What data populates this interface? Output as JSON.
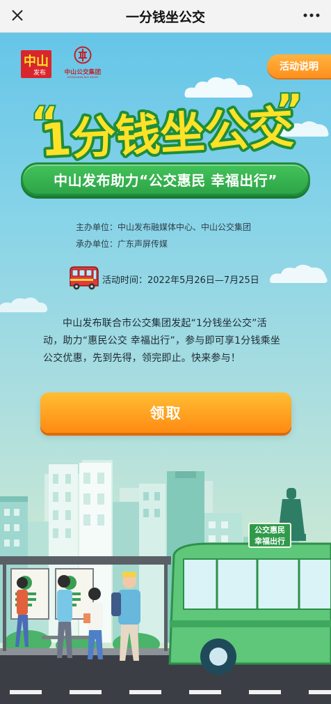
{
  "nav": {
    "title": "一分钱坐公交",
    "close_icon": "close-icon",
    "more_icon": "more-dots-icon"
  },
  "logos": {
    "zhongshan_fabu": "中山",
    "zhongshan_fabu_sub": "发布",
    "zhongshan_bus_name": "中山公交集团",
    "zhongshan_bus_en": "ZHONGSHAN BUS GROUP"
  },
  "rules_button": "活动说明",
  "title": {
    "open_quote": "“",
    "text": "1分钱坐公交",
    "close_quote": "”"
  },
  "subtitle": "中山发布助力“公交惠民 幸福出行”",
  "organizers": {
    "host": "主办单位：中山发布融媒体中心、中山公交集团",
    "organizer": "承办单位：广东声屏传媒"
  },
  "activity_time": "活动时间：2022年5月26日—7月25日",
  "description": "中山发布联合市公交集团发起“1分钱坐公交”活动，助力“惠民公交 幸福出行”，参与即可享1分钱乘坐公交优惠，先到先得，领完即止。快来参与！",
  "claim_button": "领取",
  "bus_sign": {
    "line1": "公交惠民",
    "line2": "幸福出行"
  },
  "colors": {
    "accent_orange": "#ff8f1c",
    "title_green": "#2ea548",
    "title_yellow": "#ffe227",
    "sky_blue": "#5fc3e8"
  }
}
